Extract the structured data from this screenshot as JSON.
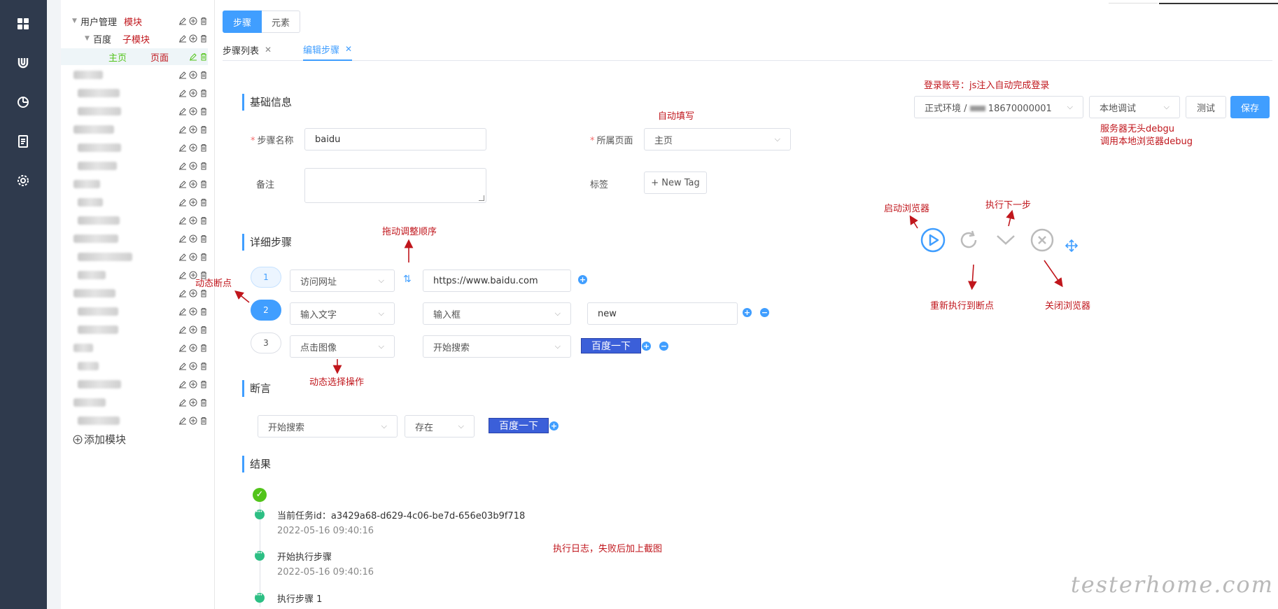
{
  "rail": {
    "icons": [
      "dashboard-icon",
      "magnet-icon",
      "chart-icon",
      "document-icon",
      "settings-icon"
    ]
  },
  "tree": {
    "root": {
      "label": "用户管理",
      "anno": "模块"
    },
    "child": {
      "label": "百度",
      "anno": "子模块"
    },
    "leaf": {
      "label": "主页",
      "anno": "页面"
    },
    "add_label": "添加模块"
  },
  "main": {
    "seg": {
      "steps": "步骤",
      "elements": "元素"
    },
    "tabs": [
      {
        "label": "步骤列表"
      },
      {
        "label": "编辑步骤"
      }
    ],
    "basic": {
      "title": "基础信息",
      "step_name_label": "步骤名称",
      "step_name_value": "baidu",
      "page_label": "所属页面",
      "page_value": "主页",
      "remark_label": "备注",
      "tag_label": "标签",
      "new_tag": "+ New Tag"
    },
    "toolbar": {
      "env_value": "正式环境 /",
      "account": "18670000001",
      "debug_mode": "本地调试",
      "test": "测试",
      "save": "保存"
    },
    "detail": {
      "title": "详细步骤",
      "steps": [
        {
          "num": "1",
          "action": "访问网址",
          "target": "https://www.baidu.com",
          "extra": ""
        },
        {
          "num": "2",
          "action": "输入文字",
          "target": "输入框",
          "extra": "new"
        },
        {
          "num": "3",
          "action": "点击图像",
          "target": "开始搜索",
          "extra": "百度一下"
        }
      ]
    },
    "assert": {
      "title": "断言",
      "element": "开始搜索",
      "condition": "存在",
      "value": "百度一下"
    },
    "result": {
      "title": "结果",
      "items": [
        {
          "text": "当前任务id：a3429a68-d629-4c06-be7d-656e03b9f718",
          "time": "2022-05-16 09:40:16"
        },
        {
          "text": "开始执行步骤",
          "time": "2022-05-16 09:40:16"
        },
        {
          "text": "执行步骤 1",
          "time": ""
        }
      ]
    }
  },
  "annotations": {
    "auto_fill": "自动填写",
    "login": "登录账号：js注入自动完成登录",
    "headless": "服务器无头debgu",
    "local": "调用本地浏览器debug",
    "launch": "启动浏览器",
    "next_step": "执行下一步",
    "rerun": "重新执行到断点",
    "close": "关闭浏览器",
    "drag": "拖动调整顺序",
    "breakpoint": "动态断点",
    "select_op": "动态选择操作",
    "log": "执行日志，失败后加上截图"
  },
  "watermark": "testerhome.com",
  "colors": {
    "primary": "#409eff",
    "sidebar": "#2f3a4d",
    "annotation": "#c0161c",
    "success": "#52c41a",
    "element_chip": "#3b5fd9"
  }
}
